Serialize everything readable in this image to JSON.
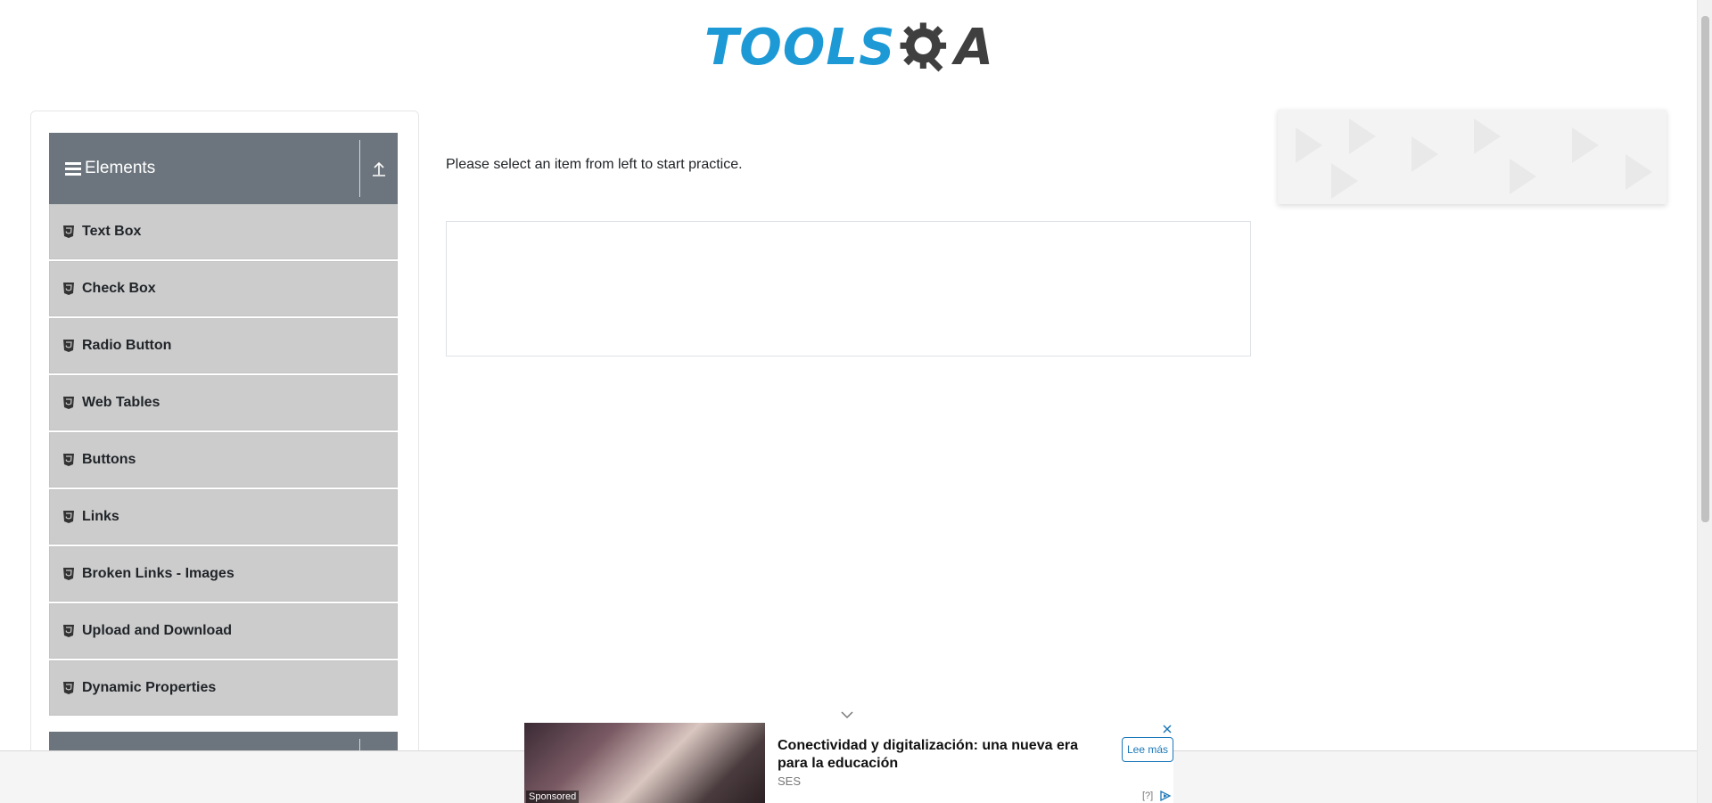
{
  "header": {
    "logo_tools": "TOOLS",
    "logo_qa": "A",
    "logo_alt": "TOOLSQA"
  },
  "sidebar": {
    "group_title": "Elements",
    "items": [
      {
        "label": "Text Box"
      },
      {
        "label": "Check Box"
      },
      {
        "label": "Radio Button"
      },
      {
        "label": "Web Tables"
      },
      {
        "label": "Buttons"
      },
      {
        "label": "Links"
      },
      {
        "label": "Broken Links - Images"
      },
      {
        "label": "Upload and Download"
      },
      {
        "label": "Dynamic Properties"
      }
    ]
  },
  "main": {
    "intro": "Please select an item from left to start practice."
  },
  "bottom_ad": {
    "headline": "Conectividad y digitalización: una nueva era para la educación",
    "advertiser": "SES",
    "cta": "Lee más",
    "sponsored": "Sponsored",
    "info": "[?]"
  },
  "colors": {
    "brand_blue": "#1d9ad6",
    "header_gray": "#6c757d",
    "item_gray": "#cccccc"
  },
  "icons": [
    "hamburger-icon",
    "collapse-up-icon",
    "html5-icon",
    "chevron-down-icon",
    "close-icon",
    "adchoices-icon"
  ]
}
